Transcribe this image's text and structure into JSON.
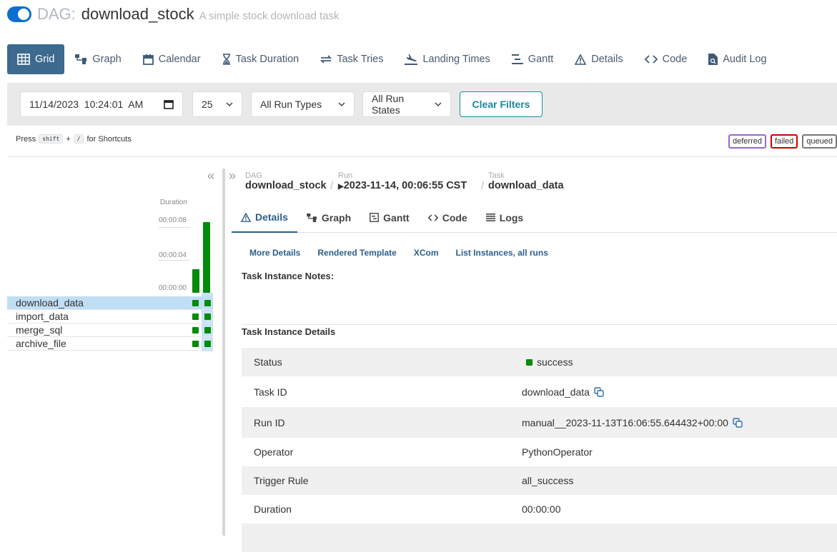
{
  "header": {
    "prefix": "DAG:",
    "dag_id": "download_stock",
    "description": "A simple stock download task"
  },
  "nav": [
    {
      "label": "Grid",
      "icon": "grid-icon"
    },
    {
      "label": "Graph",
      "icon": "graph-icon"
    },
    {
      "label": "Calendar",
      "icon": "calendar-icon"
    },
    {
      "label": "Task Duration",
      "icon": "hourglass-icon"
    },
    {
      "label": "Task Tries",
      "icon": "retry-icon"
    },
    {
      "label": "Landing Times",
      "icon": "plane-landing-icon"
    },
    {
      "label": "Gantt",
      "icon": "gantt-icon"
    },
    {
      "label": "Details",
      "icon": "warning-triangle-icon"
    },
    {
      "label": "Code",
      "icon": "code-icon"
    },
    {
      "label": "Audit Log",
      "icon": "audit-log-icon"
    }
  ],
  "filters": {
    "datetime": "11/14/2023  10:24:01  AM",
    "num_runs": "25",
    "run_types": "All Run Types",
    "run_states": "All Run States",
    "clear_label": "Clear Filters"
  },
  "shortcuts": {
    "press": "Press",
    "key1": "shift",
    "plus": "+",
    "key2": "/",
    "suffix": "for Shortcuts"
  },
  "legend": [
    {
      "label": "deferred",
      "color": "#9966cc"
    },
    {
      "label": "failed",
      "color": "#cc0000"
    },
    {
      "label": "queued",
      "color": "#777777"
    }
  ],
  "grid": {
    "duration_label": "Duration",
    "ticks": [
      "00:00:08",
      "00:00:04",
      "00:00:00"
    ],
    "run_durations_sec": [
      2.7,
      8.1
    ],
    "tasks": [
      "download_data",
      "import_data",
      "merge_sql",
      "archive_file"
    ],
    "success_color": "#058a0a"
  },
  "breadcrumb": {
    "dag_label": "DAG",
    "dag_value": "download_stock",
    "run_label": "Run",
    "run_value": "2023-11-14, 00:06:55 CST",
    "task_label": "Task",
    "task_value": "download_data"
  },
  "tabs": [
    {
      "label": "Details",
      "icon": "warning-triangle-icon"
    },
    {
      "label": "Graph",
      "icon": "graph-icon"
    },
    {
      "label": "Gantt",
      "icon": "gantt-icon"
    },
    {
      "label": "Code",
      "icon": "code-icon"
    },
    {
      "label": "Logs",
      "icon": "logs-icon"
    }
  ],
  "sublinks": [
    "More Details",
    "Rendered Template",
    "XCom",
    "List Instances, all runs"
  ],
  "notes_title": "Task Instance Notes:",
  "details_title": "Task Instance Details",
  "details": [
    {
      "key": "Status",
      "value": "success"
    },
    {
      "key": "Task ID",
      "value": "download_data"
    },
    {
      "key": "Run ID",
      "value": "manual__2023-11-13T16:06:55.644432+00:00"
    },
    {
      "key": "Operator",
      "value": "PythonOperator"
    },
    {
      "key": "Trigger Rule",
      "value": "all_success"
    },
    {
      "key": "Duration",
      "value": "00:00:00"
    }
  ]
}
